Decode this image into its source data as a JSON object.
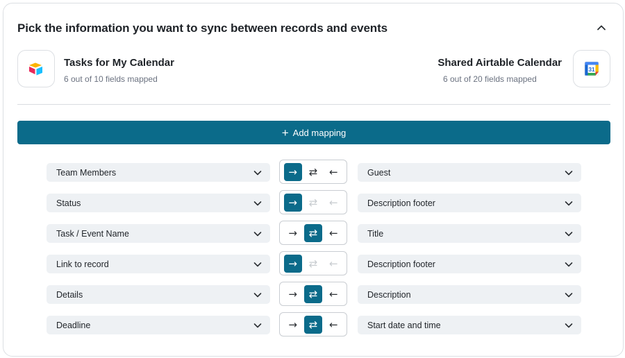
{
  "header": {
    "title": "Pick the information you want to sync between records and events"
  },
  "source": {
    "name": "Tasks for My Calendar",
    "mapped": "6 out of 10 fields mapped",
    "logo_icon": "airtable-logo"
  },
  "target": {
    "name": "Shared Airtable Calendar",
    "mapped": "6 out of 20 fields mapped",
    "logo_icon": "google-calendar-logo",
    "logo_text": "31"
  },
  "add_mapping": {
    "label": "Add mapping",
    "plus": "+"
  },
  "direction_glyphs": {
    "to_right": "→",
    "both": "⇄",
    "to_left": "←"
  },
  "colors": {
    "accent": "#0b6b8a",
    "field_bg": "#eef1f4"
  },
  "mappings": [
    {
      "left": "Team Members",
      "right": "Guest",
      "direction": "to_right",
      "state": [
        "active",
        "normal",
        "normal"
      ]
    },
    {
      "left": "Status",
      "right": "Description footer",
      "direction": "to_right",
      "state": [
        "active",
        "disabled",
        "disabled"
      ]
    },
    {
      "left": "Task / Event Name",
      "right": "Title",
      "direction": "both",
      "state": [
        "normal",
        "active",
        "normal"
      ]
    },
    {
      "left": "Link to record",
      "right": "Description footer",
      "direction": "to_right",
      "state": [
        "active",
        "disabled",
        "disabled"
      ]
    },
    {
      "left": "Details",
      "right": "Description",
      "direction": "both",
      "state": [
        "normal",
        "active",
        "normal"
      ]
    },
    {
      "left": "Deadline",
      "right": "Start date and time",
      "direction": "both",
      "state": [
        "normal",
        "active",
        "normal"
      ]
    }
  ]
}
